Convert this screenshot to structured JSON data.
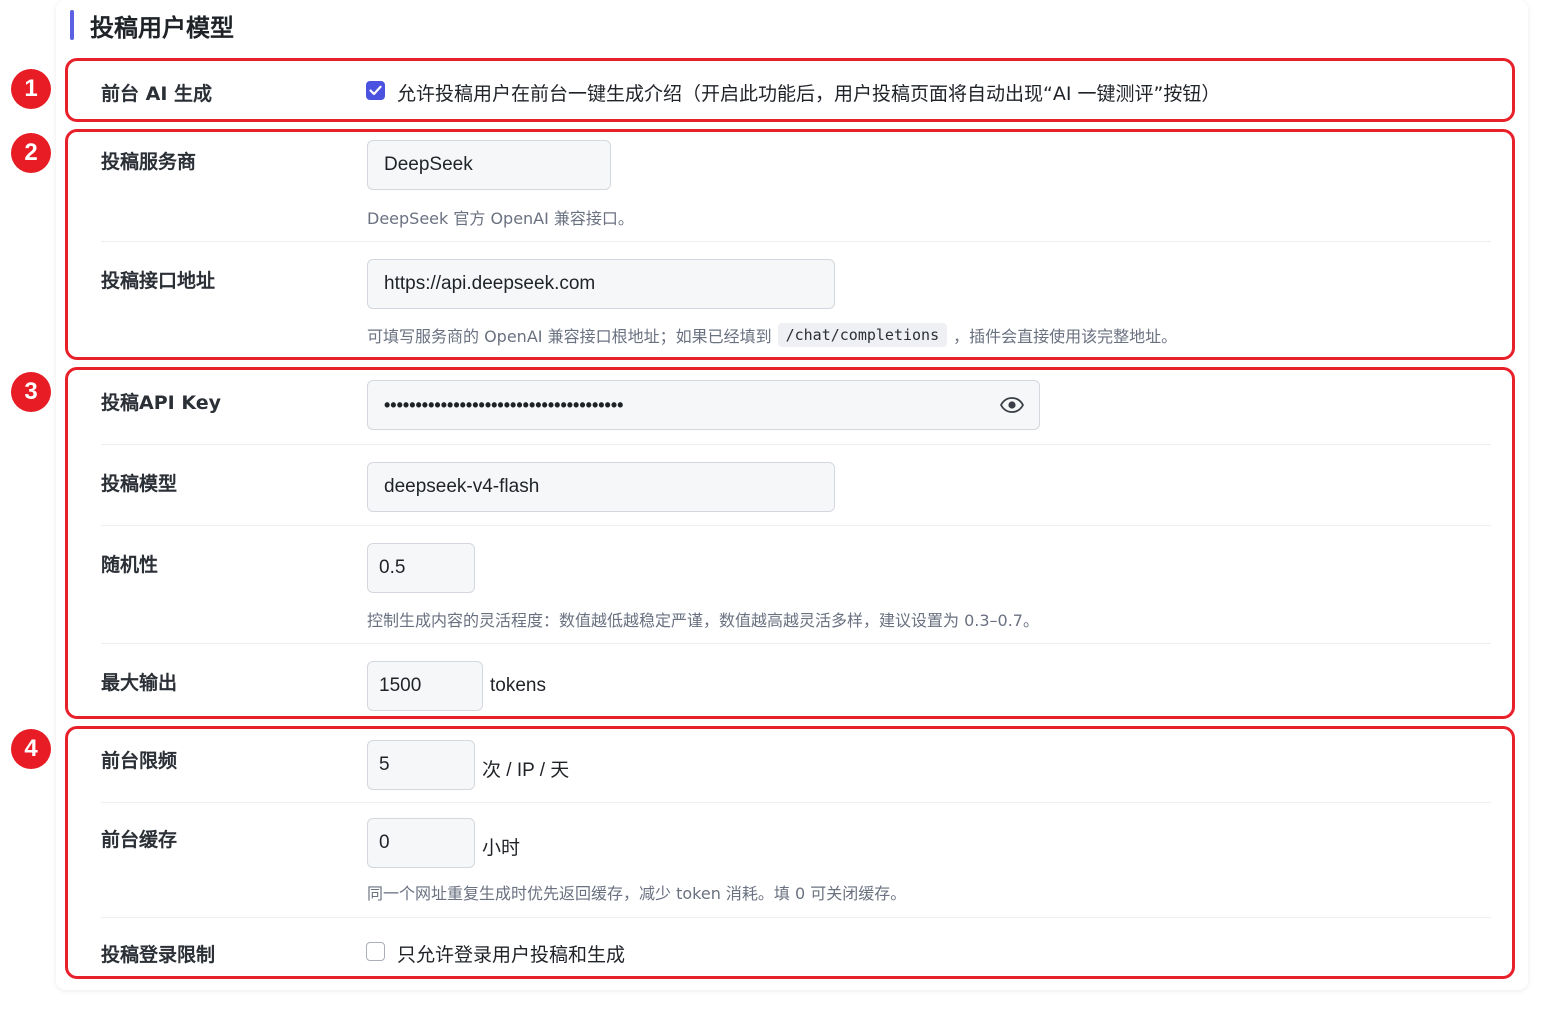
{
  "section_title": "投稿用户模型",
  "badges": [
    "1",
    "2",
    "3",
    "4"
  ],
  "frontend_ai": {
    "label": "前台 AI 生成",
    "checked": true,
    "checkbox_label": "允许投稿用户在前台一键生成介绍（开启此功能后，用户投稿页面将自动出现“AI 一键测评”按钮）"
  },
  "provider": {
    "label": "投稿服务商",
    "value": "DeepSeek",
    "help": "DeepSeek 官方 OpenAI 兼容接口。"
  },
  "endpoint": {
    "label": "投稿接口地址",
    "value": "https://api.deepseek.com",
    "help_before": "可填写服务商的 OpenAI 兼容接口根地址；如果已经填到",
    "help_code": "/chat/completions",
    "help_after": "，插件会直接使用该完整地址。"
  },
  "api_key": {
    "label": "投稿API Key",
    "masked_value": "••••••••••••••••••••••••••••••••••••••",
    "toggle_icon": "eye-icon"
  },
  "model": {
    "label": "投稿模型",
    "value": "deepseek-v4-flash"
  },
  "temperature": {
    "label": "随机性",
    "value": "0.5",
    "help": "控制生成内容的灵活程度：数值越低越稳定严谨，数值越高越灵活多样，建议设置为 0.3–0.7。"
  },
  "max_output": {
    "label": "最大输出",
    "value": "1500",
    "unit": "tokens"
  },
  "rate_limit": {
    "label": "前台限频",
    "value": "5",
    "unit": "次 / IP / 天"
  },
  "cache": {
    "label": "前台缓存",
    "value": "0",
    "unit": "小时",
    "help": "同一个网址重复生成时优先返回缓存，减少 token 消耗。填 0 可关闭缓存。"
  },
  "login_limit": {
    "label": "投稿登录限制",
    "checked": false,
    "checkbox_label": "只允许登录用户投稿和生成"
  },
  "colors": {
    "accent": "#4b52e0",
    "highlight_border": "#e8202a",
    "badge": "#e81c24"
  }
}
